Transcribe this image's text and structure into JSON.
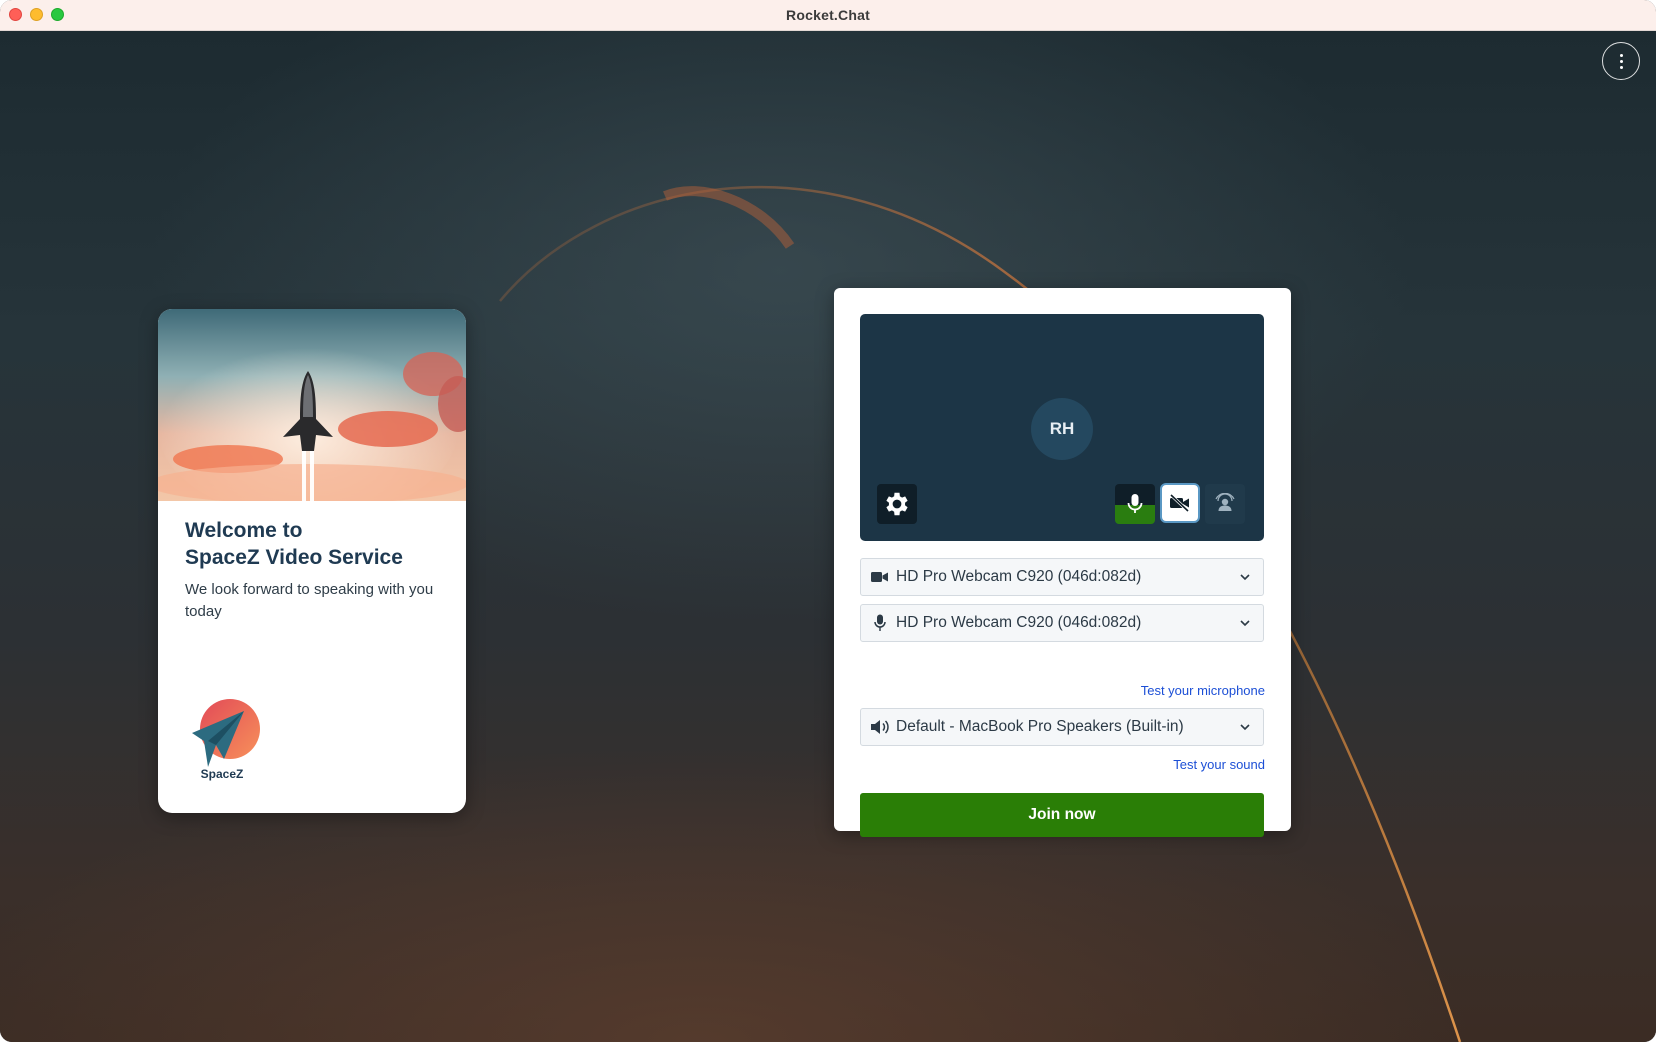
{
  "window": {
    "title": "Rocket.Chat"
  },
  "menu": {
    "icon": "more-vertical-icon"
  },
  "welcome": {
    "title_line1": "Welcome to",
    "title_line2": "SpaceZ Video Service",
    "subtitle": "We look forward to speaking with you today",
    "logo_text": "SpaceZ"
  },
  "prejoin": {
    "avatar_initials": "RH",
    "controls": {
      "settings_icon": "gear-icon",
      "mic_icon": "microphone-icon",
      "camera_icon": "camera-off-icon",
      "background_icon": "background-blur-icon"
    },
    "camera_select": {
      "icon": "video-camera-icon",
      "value": "HD Pro Webcam C920 (046d:082d)"
    },
    "mic_select": {
      "icon": "microphone-icon",
      "value": "HD Pro Webcam C920 (046d:082d)"
    },
    "test_mic_link": "Test your microphone",
    "speaker_select": {
      "icon": "speaker-icon",
      "value": "Default - MacBook Pro Speakers (Built-in)"
    },
    "test_sound_link": "Test your sound",
    "join_button": "Join now"
  },
  "colors": {
    "join_green": "#2a7e06",
    "link_blue": "#1c4fd6",
    "preview_bg": "#1c3546",
    "title_navy": "#1f3a52"
  }
}
